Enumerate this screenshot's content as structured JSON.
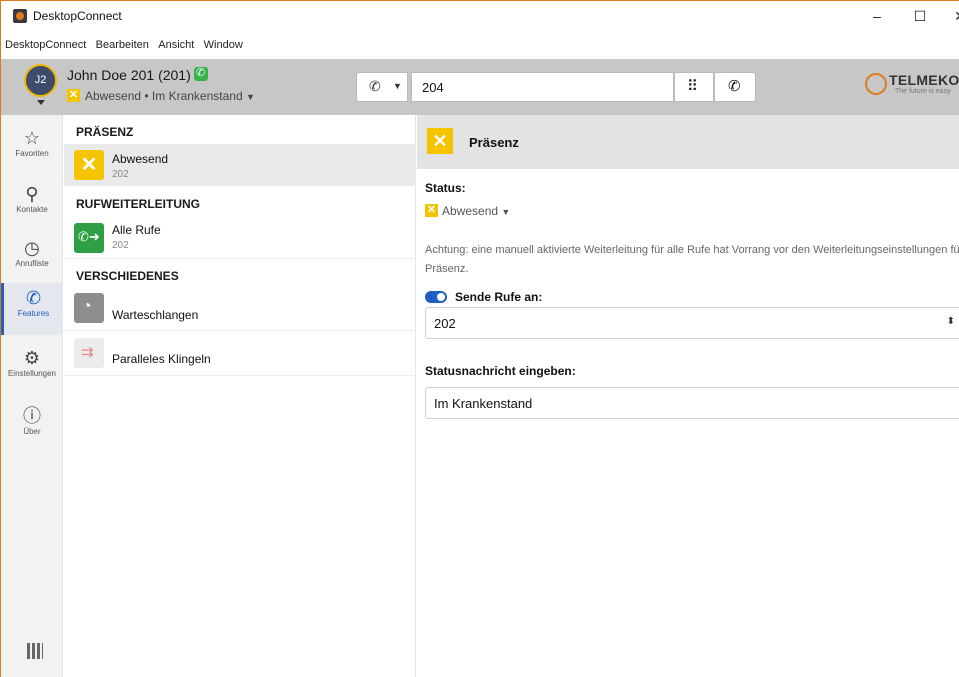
{
  "window": {
    "title": "DesktopConnect",
    "controls": {
      "minimize": "–",
      "maximize": "☐",
      "close": "✕"
    }
  },
  "menubar": {
    "items": [
      "DesktopConnect",
      "Bearbeiten",
      "Ansicht",
      "Window"
    ]
  },
  "header": {
    "avatar_initials": "J2",
    "user_name": "John Doe 201 (201)",
    "status": "Abwesend • Im Krankenstand",
    "status_icon": "x-icon",
    "dial_value": "204",
    "call_mode_icon": "ip-phone-icon",
    "logo_name": "TELMEKOM",
    "logo_tagline": "The future is easy"
  },
  "leftnav": {
    "items": [
      {
        "label": "Favoriten",
        "icon": "star-icon"
      },
      {
        "label": "Kontakte",
        "icon": "person-icon"
      },
      {
        "label": "Anrufliste",
        "icon": "clock-icon"
      },
      {
        "label": "Features",
        "icon": "phone-dots-icon",
        "active": true
      },
      {
        "label": "Einstellungen",
        "icon": "gear-icon"
      },
      {
        "label": "Über",
        "icon": "info-icon"
      }
    ]
  },
  "midlist": {
    "sections": [
      {
        "title": "PRÄSENZ",
        "items": [
          {
            "title": "Abwesend",
            "sub": "202",
            "selected": true
          }
        ]
      },
      {
        "title": "RUFWEITERLEITUNG",
        "items": [
          {
            "title": "Alle Rufe",
            "sub": "202"
          }
        ]
      },
      {
        "title": "VERSCHIEDENES",
        "items": [
          {
            "title": "Warteschlangen",
            "sub": ""
          },
          {
            "title": "Paralleles Klingeln",
            "sub": ""
          }
        ]
      }
    ]
  },
  "detail": {
    "title": "Präsenz",
    "status_label": "Status:",
    "status_value": "Abwesend",
    "note": "Achtung: eine manuell aktivierte Weiterleitung für alle Rufe hat Vorrang vor den Weiterleitungseinstellungen für Präsenz.",
    "forward_toggle_label": "Sende Rufe an:",
    "forward_toggle_on": true,
    "forward_target": "202",
    "status_message_label": "Statusnachricht eingeben:",
    "status_message_value": "Im Krankenstand"
  },
  "colors": {
    "accent": "#1f5fbf",
    "absent": "#f5c400",
    "forward": "#2f9e44",
    "header_bg": "#c7c7c7",
    "brand": "#e07b1a"
  }
}
